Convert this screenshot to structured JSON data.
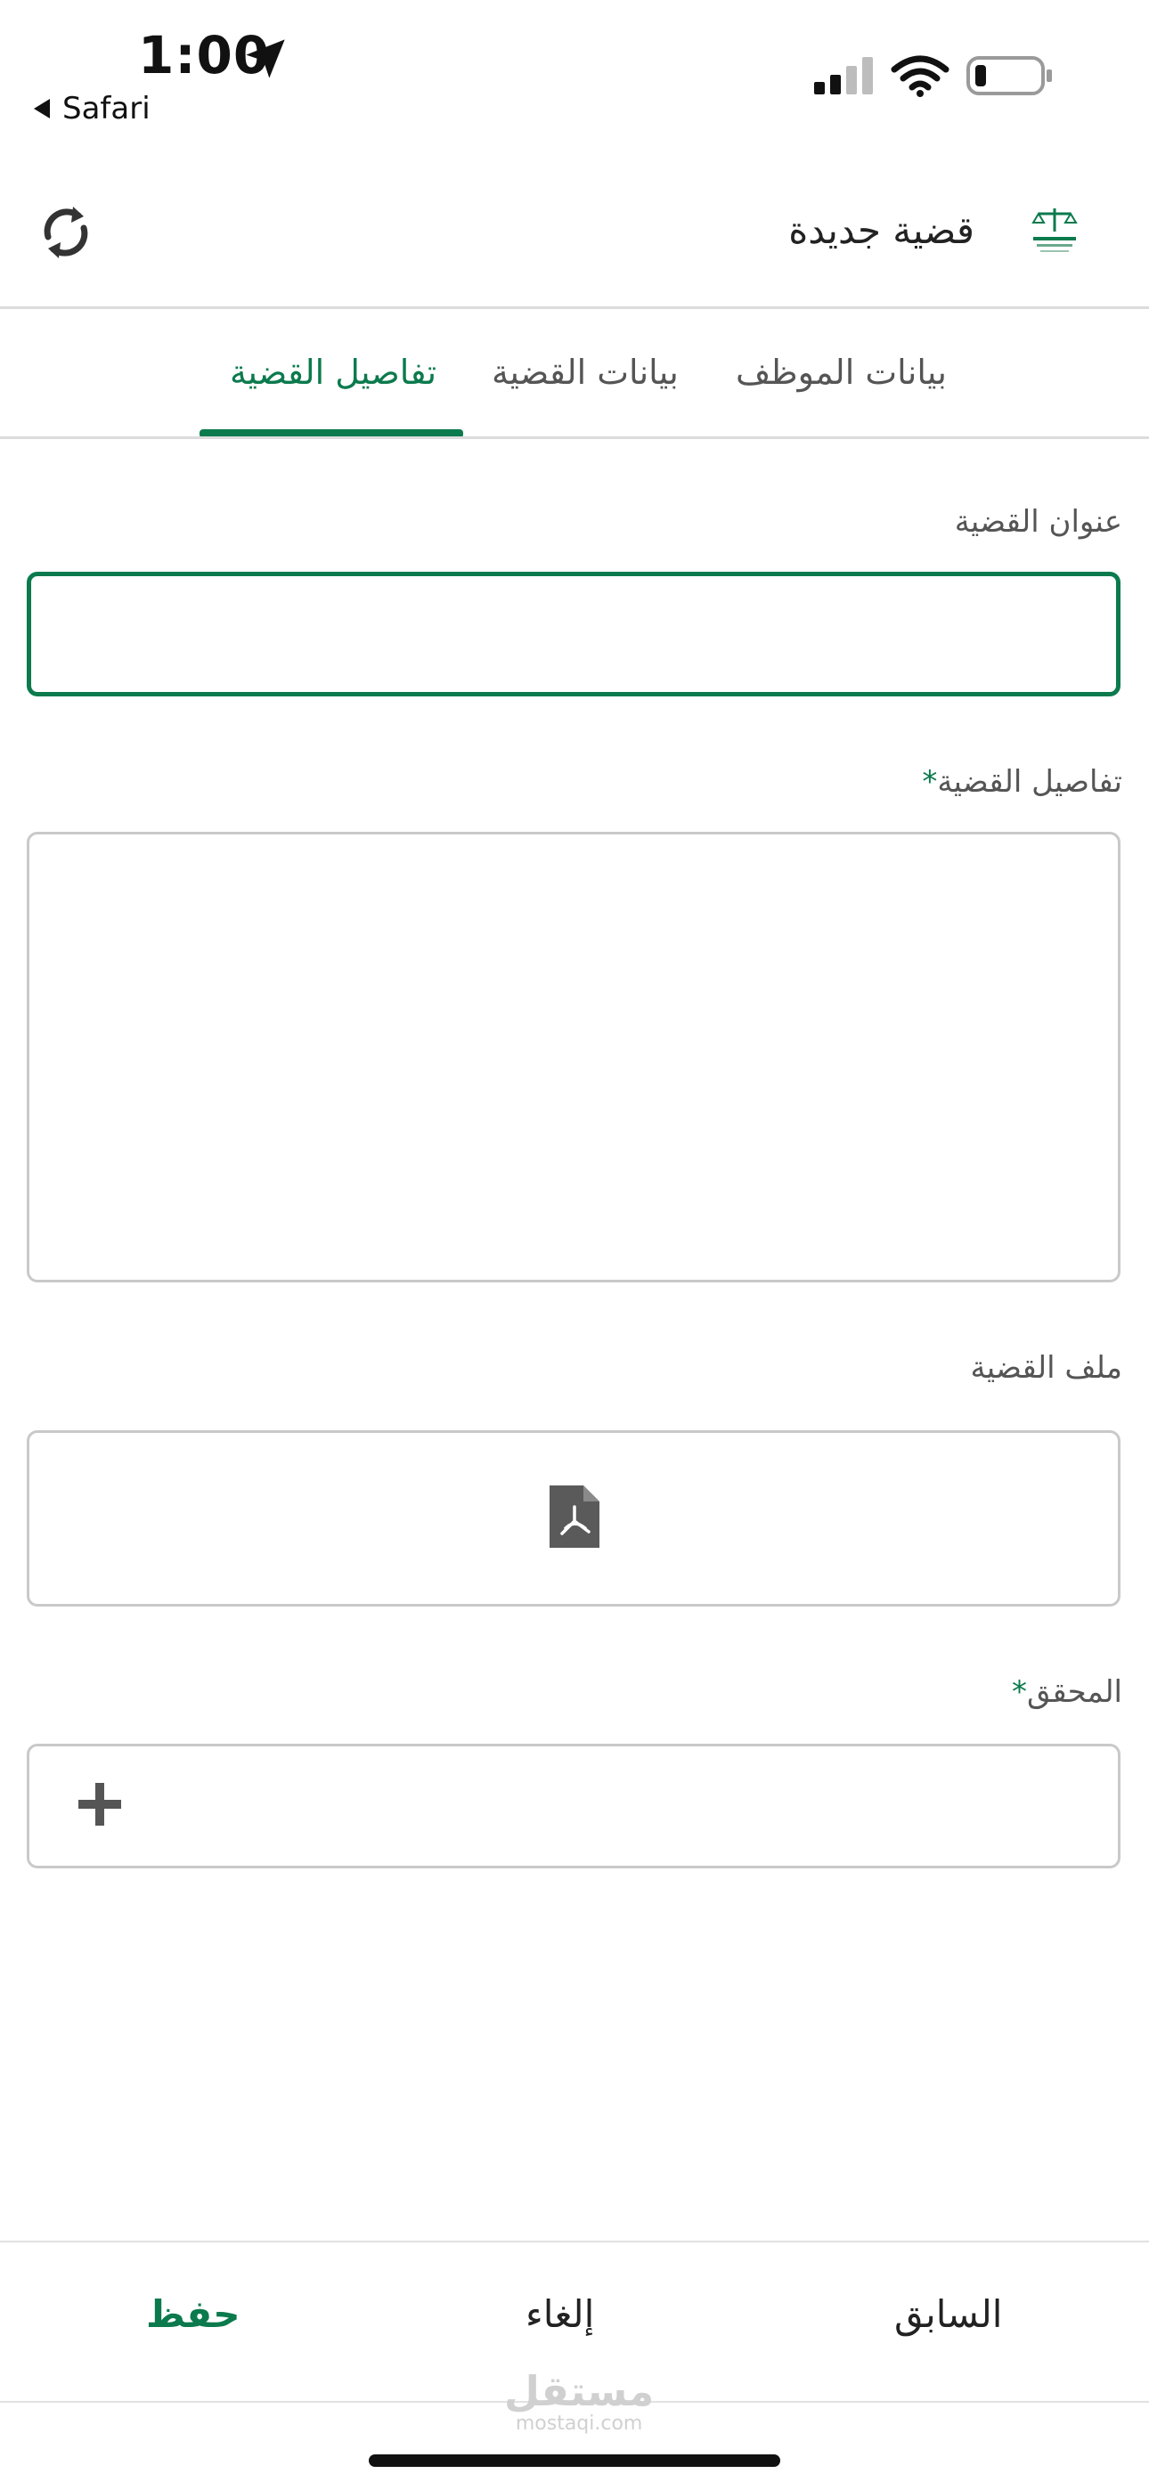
{
  "status_bar": {
    "time": "1:00",
    "back_to": "Safari"
  },
  "header": {
    "title": "قضية جديدة"
  },
  "tabs": [
    {
      "label": "بيانات الموظف"
    },
    {
      "label": "بيانات القضية"
    },
    {
      "label": "تفاصيل القضية",
      "active": true
    }
  ],
  "form": {
    "title_label": "عنوان القضية",
    "title_value": "",
    "details_label": "تفاصيل القضية",
    "details_value": "",
    "file_label": "ملف القضية",
    "investigator_label": "المحقق",
    "required_marker": "*"
  },
  "footer": {
    "save": "حفظ",
    "cancel": "إلغاء",
    "previous": "السابق",
    "watermark_ar": "مستقل",
    "watermark_en": "mostaqi.com"
  },
  "colors": {
    "accent": "#0b7a4d",
    "border": "#c9c9c9",
    "text": "#333333"
  }
}
